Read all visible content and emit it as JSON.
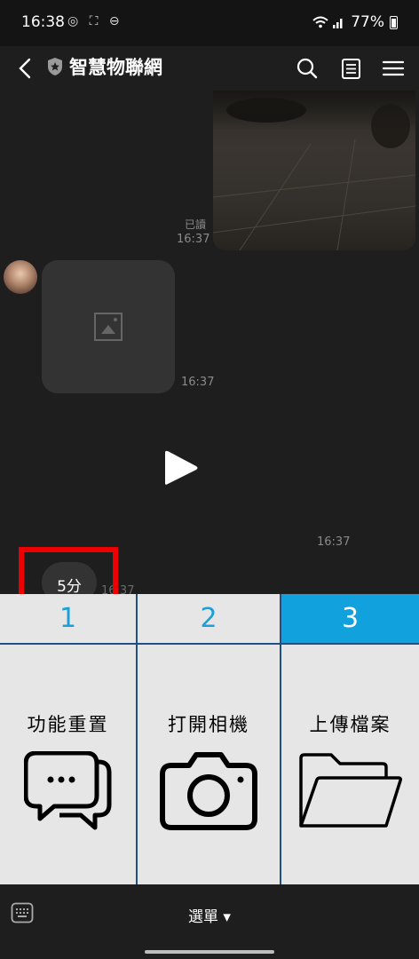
{
  "status_bar": {
    "time": "16:38",
    "left_icons": "◎ ⛶ ⊖",
    "signal_icons": "wifi-signal-icons",
    "battery": "77%"
  },
  "header": {
    "title": "智慧物聯網",
    "back_icon": "chevron-left-icon",
    "shield_icon": "shield-icon",
    "search_icon": "search-icon",
    "notes_icon": "notes-icon",
    "menu_icon": "hamburger-icon"
  },
  "chat": {
    "read_label": "已讀",
    "sent_time": "16:37",
    "image_time": "16:37",
    "video_time": "16:37",
    "duration_time": "16:37",
    "duration_label": "5分"
  },
  "rich_menu": {
    "tabs": [
      {
        "label": "1",
        "active": false
      },
      {
        "label": "2",
        "active": false
      },
      {
        "label": "3",
        "active": true
      }
    ],
    "cells": [
      {
        "label": "功能重置",
        "icon": "chat-bubbles-icon"
      },
      {
        "label": "打開相機",
        "icon": "camera-icon"
      },
      {
        "label": "上傳檔案",
        "icon": "folder-icon"
      }
    ],
    "colors": {
      "active_tab": "#11a1dd",
      "tab_text": "#1a9fd8",
      "border": "#1f4f86",
      "highlight_box": "#ef0000"
    }
  },
  "bottom_bar": {
    "keyboard_icon": "keyboard-icon",
    "menu_label": "選單 ▾"
  }
}
